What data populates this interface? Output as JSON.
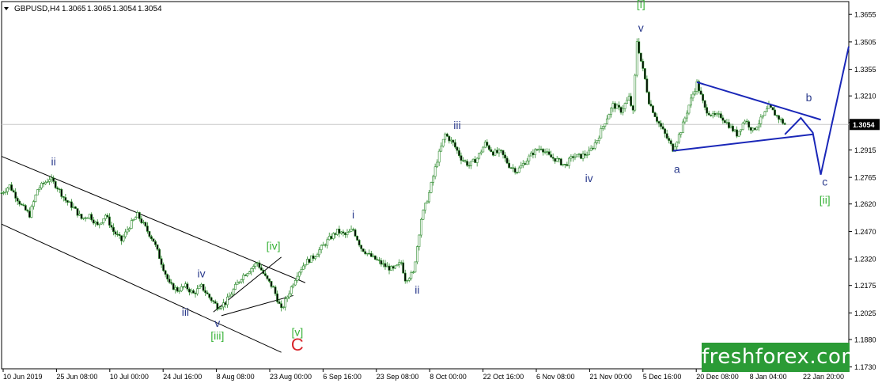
{
  "chart_data": {
    "type": "candlestick",
    "header": {
      "symbol": "GBPUSD,H4",
      "open": "1.3065",
      "high": "1.3065",
      "low": "1.3054",
      "close": "1.3054"
    },
    "current_price": "1.3054",
    "ylim": [
      1.172,
      1.3725
    ],
    "y_ticks": [
      "1.3655",
      "1.3505",
      "1.3355",
      "1.3210",
      "1.3065",
      "1.2915",
      "1.2765",
      "1.2620",
      "1.2470",
      "1.2320",
      "1.2175",
      "1.2025",
      "1.1880",
      "1.1730"
    ],
    "x_ticks": [
      "10 Jun 2019",
      "25 Jun 08:00",
      "10 Jul 00:00",
      "24 Jul 16:00",
      "8 Aug 08:00",
      "23 Aug 00:00",
      "6 Sep 16:00",
      "23 Sep 08:00",
      "8 Oct 00:00",
      "22 Oct 16:00",
      "6 Nov 08:00",
      "21 Nov 00:00",
      "5 Dec 16:00",
      "20 Dec 08:00",
      "8 Jan 04:00",
      "22 Jan 20:00"
    ],
    "price_path": [
      [
        0,
        1.268
      ],
      [
        2,
        1.272
      ],
      [
        5,
        1.261
      ],
      [
        7,
        1.256
      ],
      [
        9,
        1.27
      ],
      [
        12,
        1.276
      ],
      [
        14,
        1.271
      ],
      [
        16,
        1.264
      ],
      [
        18,
        1.26
      ],
      [
        20,
        1.254
      ],
      [
        22,
        1.256
      ],
      [
        24,
        1.25
      ],
      [
        26,
        1.256
      ],
      [
        28,
        1.247
      ],
      [
        30,
        1.242
      ],
      [
        32,
        1.25
      ],
      [
        34,
        1.256
      ],
      [
        36,
        1.249
      ],
      [
        38,
        1.242
      ],
      [
        40,
        1.23
      ],
      [
        42,
        1.218
      ],
      [
        44,
        1.215
      ],
      [
        46,
        1.217
      ],
      [
        48,
        1.213
      ],
      [
        50,
        1.217
      ],
      [
        52,
        1.211
      ],
      [
        54,
        1.206
      ],
      [
        56,
        1.208
      ],
      [
        58,
        1.215
      ],
      [
        60,
        1.222
      ],
      [
        62,
        1.226
      ],
      [
        64,
        1.23
      ],
      [
        66,
        1.222
      ],
      [
        68,
        1.216
      ],
      [
        70,
        1.204
      ],
      [
        72,
        1.214
      ],
      [
        74,
        1.224
      ],
      [
        76,
        1.23
      ],
      [
        78,
        1.233
      ],
      [
        80,
        1.238
      ],
      [
        82,
        1.243
      ],
      [
        84,
        1.247
      ],
      [
        86,
        1.245
      ],
      [
        88,
        1.248
      ],
      [
        90,
        1.238
      ],
      [
        92,
        1.234
      ],
      [
        94,
        1.231
      ],
      [
        96,
        1.228
      ],
      [
        98,
        1.226
      ],
      [
        100,
        1.23
      ],
      [
        101,
        1.221
      ],
      [
        103,
        1.224
      ],
      [
        105,
        1.254
      ],
      [
        107,
        1.268
      ],
      [
        109,
        1.286
      ],
      [
        111,
        1.3
      ],
      [
        113,
        1.295
      ],
      [
        115,
        1.287
      ],
      [
        117,
        1.283
      ],
      [
        119,
        1.287
      ],
      [
        121,
        1.295
      ],
      [
        123,
        1.29
      ],
      [
        125,
        1.29
      ],
      [
        127,
        1.283
      ],
      [
        129,
        1.28
      ],
      [
        131,
        1.285
      ],
      [
        133,
        1.29
      ],
      [
        135,
        1.293
      ],
      [
        137,
        1.288
      ],
      [
        139,
        1.286
      ],
      [
        141,
        1.283
      ],
      [
        143,
        1.288
      ],
      [
        145,
        1.288
      ],
      [
        147,
        1.29
      ],
      [
        149,
        1.297
      ],
      [
        151,
        1.307
      ],
      [
        153,
        1.316
      ],
      [
        155,
        1.313
      ],
      [
        157,
        1.32
      ],
      [
        158,
        1.312
      ],
      [
        159,
        1.351
      ],
      [
        160,
        1.34
      ],
      [
        161,
        1.33
      ],
      [
        162,
        1.318
      ],
      [
        164,
        1.308
      ],
      [
        166,
        1.3
      ],
      [
        168,
        1.292
      ],
      [
        170,
        1.302
      ],
      [
        172,
        1.316
      ],
      [
        174,
        1.328
      ],
      [
        176,
        1.314
      ],
      [
        178,
        1.31
      ],
      [
        180,
        1.31
      ],
      [
        182,
        1.305
      ],
      [
        184,
        1.3
      ],
      [
        186,
        1.308
      ],
      [
        188,
        1.302
      ],
      [
        190,
        1.308
      ],
      [
        192,
        1.315
      ],
      [
        194,
        1.31
      ],
      [
        196,
        1.3054
      ]
    ],
    "channel_lines": [
      [
        [
          0,
          1.288
        ],
        [
          76,
          1.219
        ]
      ],
      [
        [
          0,
          1.251
        ],
        [
          70,
          1.181
        ]
      ]
    ],
    "triangle_lines": [
      [
        [
          174,
          1.3285
        ],
        [
          205,
          1.308
        ]
      ],
      [
        [
          168,
          1.291
        ],
        [
          203,
          1.3
        ]
      ],
      [
        [
          53,
          1.203
        ],
        [
          70,
          1.233
        ]
      ],
      [
        [
          55,
          1.201
        ],
        [
          73,
          1.212
        ]
      ]
    ],
    "projection_path": [
      [
        196,
        1.3
      ],
      [
        200,
        1.309
      ],
      [
        203,
        1.301
      ],
      [
        205,
        1.278
      ],
      [
        212,
        1.348
      ]
    ],
    "wave_labels": [
      {
        "text": "ii",
        "x": 13,
        "y": 1.283,
        "color": "#2a3a8c"
      },
      {
        "text": "iv",
        "x": 50,
        "y": 1.222,
        "color": "#2a3a8c"
      },
      {
        "text": "iii",
        "x": 46,
        "y": 1.201,
        "color": "#2a3a8c"
      },
      {
        "text": "v",
        "x": 54,
        "y": 1.195,
        "color": "#2a3a8c"
      },
      {
        "text": "[iii]",
        "x": 54,
        "y": 1.188,
        "color": "#3ab33a"
      },
      {
        "text": "[iv]",
        "x": 68,
        "y": 1.237,
        "color": "#3ab33a"
      },
      {
        "text": "[v]",
        "x": 74,
        "y": 1.19,
        "color": "#3ab33a"
      },
      {
        "text": "C",
        "x": 74,
        "y": 1.182,
        "color": "#d8242a"
      },
      {
        "text": "i",
        "x": 88,
        "y": 1.254,
        "color": "#2a3a8c"
      },
      {
        "text": "ii",
        "x": 104,
        "y": 1.213,
        "color": "#2a3a8c"
      },
      {
        "text": "iii",
        "x": 114,
        "y": 1.303,
        "color": "#2a3a8c"
      },
      {
        "text": "iv",
        "x": 147,
        "y": 1.274,
        "color": "#2a3a8c"
      },
      {
        "text": "v",
        "x": 160,
        "y": 1.356,
        "color": "#2a3a8c"
      },
      {
        "text": "[i]",
        "x": 160,
        "y": 1.369,
        "color": "#3ab33a"
      },
      {
        "text": "a",
        "x": 169,
        "y": 1.279,
        "color": "#2a3a8c"
      },
      {
        "text": "b",
        "x": 202,
        "y": 1.318,
        "color": "#2a3a8c"
      },
      {
        "text": "c",
        "x": 206,
        "y": 1.272,
        "color": "#2a3a8c"
      },
      {
        "text": "[ii]",
        "x": 206,
        "y": 1.262,
        "color": "#3ab33a"
      }
    ],
    "colors": {
      "candle": "#2e8b2e",
      "trend_line": "#000000",
      "projection": "#1a27b8",
      "price_label_bg": "#000000"
    }
  },
  "watermark": "freshforex.com"
}
